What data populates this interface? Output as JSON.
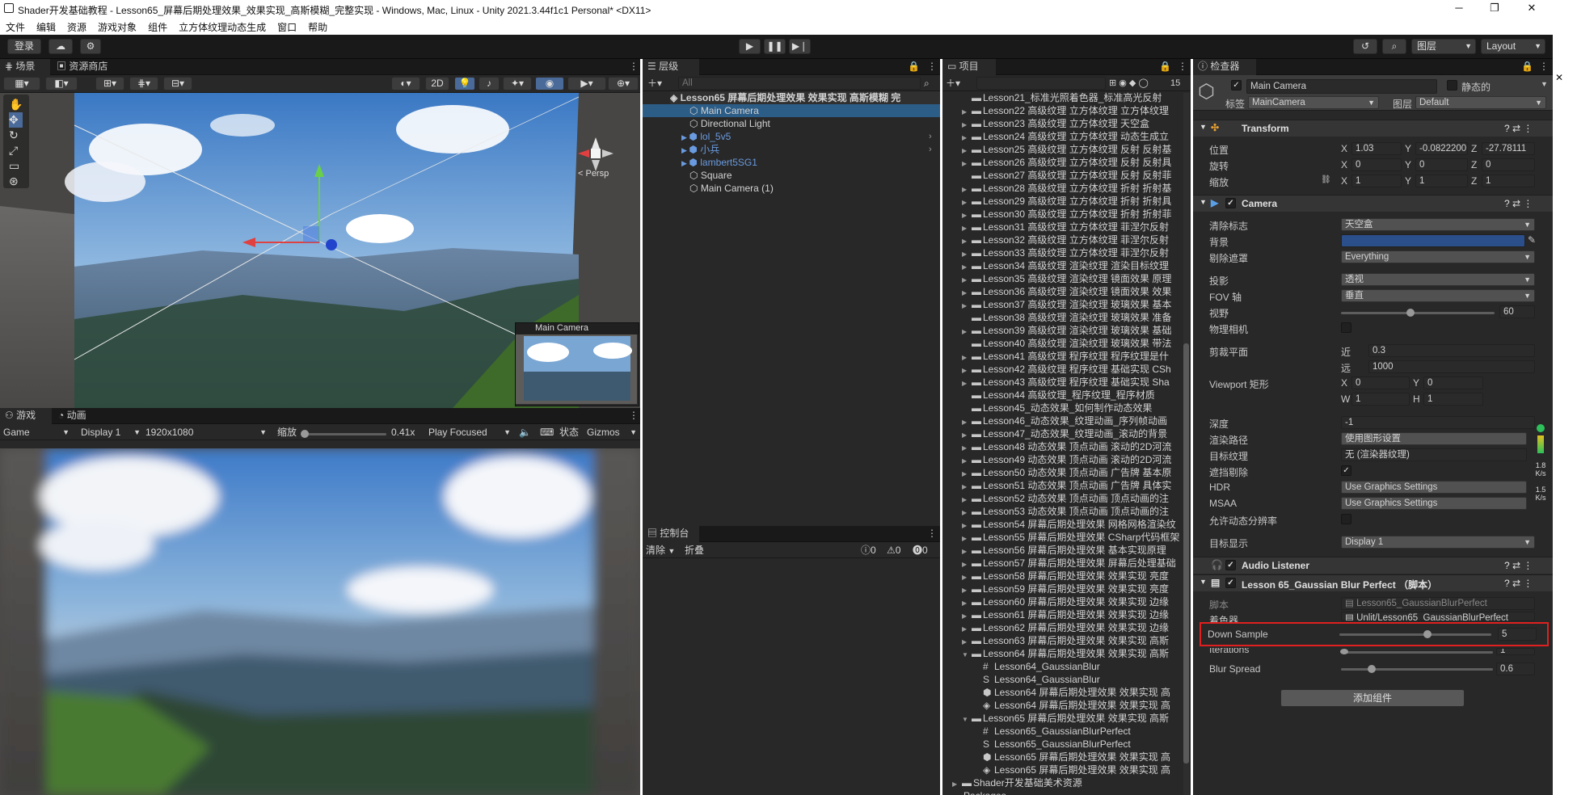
{
  "window": {
    "title": "Shader开发基础教程 - Lesson65_屏幕后期处理效果_效果实现_高斯模糊_完整实现 - Windows, Mac, Linux - Unity 2021.3.44f1c1 Personal* <DX11>",
    "min": "─",
    "max": "❐",
    "close": "✕"
  },
  "menu": [
    "文件",
    "编辑",
    "资源",
    "游戏对象",
    "组件",
    "立方体纹理动态生成",
    "窗口",
    "帮助"
  ],
  "toolbar": {
    "login": "登录",
    "layers": "图层",
    "layout": "Layout"
  },
  "scene": {
    "tab_scene": "场景",
    "tab_store": "资源商店",
    "btn_2d": "2D",
    "persp": "< Persp",
    "preview_title": "Main Camera"
  },
  "game": {
    "tab_game": "游戏",
    "tab_anim": "动画",
    "mode": "Game",
    "display": "Display 1",
    "resolution": "1920x1080",
    "scale_label": "缩放",
    "scale_value": "0.41x",
    "play_focused": "Play Focused",
    "stats": "状态",
    "gizmos": "Gizmos"
  },
  "hierarchy": {
    "tab": "层级",
    "search_placeholder": "All",
    "scene": "Lesson65 屏幕后期处理效果 效果实现 高斯模糊 完",
    "items": [
      "Main Camera",
      "Directional Light",
      "lol_5v5",
      "小兵",
      "lambert5SG1",
      "Square",
      "Main Camera (1)"
    ]
  },
  "console": {
    "tab": "控制台",
    "clear": "清除",
    "collapse": "折叠",
    "count_info": "0",
    "count_warn": "0",
    "count_err": "0"
  },
  "project": {
    "tab": "项目",
    "count": "15",
    "items": [
      "Lesson21_标准光照着色器_标准高光反射",
      "Lesson22 高级纹理 立方体纹理 立方体纹理",
      "Lesson23 高级纹理 立方体纹理 天空盒",
      "Lesson24 高级纹理 立方体纹理 动态生成立",
      "Lesson25 高级纹理 立方体纹理 反射 反射基",
      "Lesson26 高级纹理 立方体纹理 反射 反射具",
      "Lesson27 高级纹理 立方体纹理 反射 反射菲",
      "Lesson28 高级纹理 立方体纹理 折射 折射基",
      "Lesson29 高级纹理 立方体纹理 折射 折射具",
      "Lesson30 高级纹理 立方体纹理 折射 折射菲",
      "Lesson31 高级纹理 立方体纹理 菲涅尔反射",
      "Lesson32 高级纹理 立方体纹理 菲涅尔反射",
      "Lesson33 高级纹理 立方体纹理 菲涅尔反射",
      "Lesson34 高级纹理 渲染纹理 渲染目标纹理",
      "Lesson35 高级纹理 渲染纹理 镜面效果 原理",
      "Lesson36 高级纹理 渲染纹理 镜面效果 效果",
      "Lesson37 高级纹理 渲染纹理 玻璃效果 基本",
      "Lesson38 高级纹理 渲染纹理 玻璃效果 准备",
      "Lesson39 高级纹理 渲染纹理 玻璃效果 基础",
      "Lesson40 高级纹理 渲染纹理 玻璃效果 带法",
      "Lesson41 高级纹理 程序纹理 程序纹理是什",
      "Lesson42 高级纹理 程序纹理 基础实现 CSh",
      "Lesson43 高级纹理 程序纹理 基础实现 Sha",
      "Lesson44 高级纹理_程序纹理_程序材质",
      "Lesson45_动态效果_如何制作动态效果",
      "Lesson46_动态效果_纹理动画_序列帧动画",
      "Lesson47_动态效果_纹理动画_滚动的背景",
      "Lesson48 动态效果 顶点动画 滚动的2D河流",
      "Lesson49 动态效果 顶点动画 滚动的2D河流",
      "Lesson50 动态效果 顶点动画 广告牌 基本原",
      "Lesson51 动态效果 顶点动画 广告牌 具体实",
      "Lesson52 动态效果 顶点动画 顶点动画的注",
      "Lesson53 动态效果 顶点动画 顶点动画的注",
      "Lesson54 屏幕后期处理效果 网格网格渲染纹",
      "Lesson55 屏幕后期处理效果 CSharp代码框架",
      "Lesson56 屏幕后期处理效果 基本实现原理",
      "Lesson57 屏幕后期处理效果 屏幕后处理基础",
      "Lesson58 屏幕后期处理效果 效果实现 亮度",
      "Lesson59 屏幕后期处理效果 效果实现 亮度",
      "Lesson60 屏幕后期处理效果 效果实现 边缘",
      "Lesson61 屏幕后期处理效果 效果实现 边缘",
      "Lesson62 屏幕后期处理效果 效果实现 边缘",
      "Lesson63 屏幕后期处理效果 效果实现 高斯",
      "Lesson64 屏幕后期处理效果 效果实现 高斯"
    ],
    "sub64": [
      "Lesson64_GaussianBlur",
      "Lesson64_GaussianBlur",
      "Lesson64 屏幕后期处理效果 效果实现 高",
      "Lesson64 屏幕后期处理效果 效果实现 高"
    ],
    "folder65": "Lesson65 屏幕后期处理效果 效果实现 高斯",
    "sub65": [
      "Lesson65_GaussianBlurPerfect",
      "Lesson65_GaussianBlurPerfect",
      "Lesson65 屏幕后期处理效果 效果实现 高",
      "Lesson65 屏幕后期处理效果 效果实现 高"
    ],
    "assets_folder": "Shader开发基础美术资源",
    "packages": "Packages"
  },
  "inspector": {
    "tab": "检查器",
    "name": "Main Camera",
    "static": "静态的",
    "tag_label": "标签",
    "tag": "MainCamera",
    "layer_label": "图层",
    "layer": "Default",
    "transform": {
      "title": "Transform",
      "pos": "位置",
      "rot": "旋转",
      "scale": "缩放",
      "px": "1.03",
      "py": "-0.0822200",
      "pz": "-27.78111",
      "rx": "0",
      "ry": "0",
      "rz": "0",
      "sx": "1",
      "sy": "1",
      "sz": "1"
    },
    "camera": {
      "title": "Camera",
      "clear_flags_l": "清除标志",
      "clear_flags": "天空盒",
      "bg_l": "背景",
      "bg_color": "#2b4f8a",
      "culling_l": "剔除遮罩",
      "culling": "Everything",
      "proj_l": "投影",
      "proj": "透视",
      "fov_axis_l": "FOV 轴",
      "fov_axis": "垂直",
      "fov_l": "视野",
      "fov": "60",
      "fov_frac": 0.45,
      "phys_l": "物理相机",
      "clip_l": "剪裁平面",
      "near_l": "近",
      "near": "0.3",
      "far_l": "远",
      "far": "1000",
      "vp_l": "Viewport 矩形",
      "vx": "0",
      "vy": "0",
      "vw": "1",
      "vh": "1",
      "depth_l": "深度",
      "depth": "-1",
      "path_l": "渲染路径",
      "path": "使用图形设置",
      "target_l": "目标纹理",
      "target": "无 (渲染器纹理)",
      "occ_l": "遮挡剔除",
      "hdr_l": "HDR",
      "hdr": "Use Graphics Settings",
      "msaa_l": "MSAA",
      "msaa": "Use Graphics Settings",
      "dyn_l": "允许动态分辨率",
      "disp_l": "目标显示",
      "disp": "Display 1"
    },
    "fps": {
      "a": "1.8",
      "a_unit": "K/s",
      "b": "1.5",
      "b_unit": "K/s"
    },
    "audio": {
      "title": "Audio Listener"
    },
    "script": {
      "title": "Lesson 65_Gaussian Blur Perfect （脚本）",
      "script_l": "脚本",
      "script": "Lesson65_GaussianBlurPerfect",
      "shader_l": "着色器",
      "shader": "Unlit/Lesson65_GaussianBlurPerfect",
      "ds_l": "Down Sample",
      "ds": "5",
      "ds_frac": 0.58,
      "it_l": "Iterations",
      "it": "1",
      "it_frac": 0.02,
      "bs_l": "Blur Spread",
      "bs": "0.6",
      "bs_frac": 0.2
    },
    "add_component": "添加组件"
  }
}
